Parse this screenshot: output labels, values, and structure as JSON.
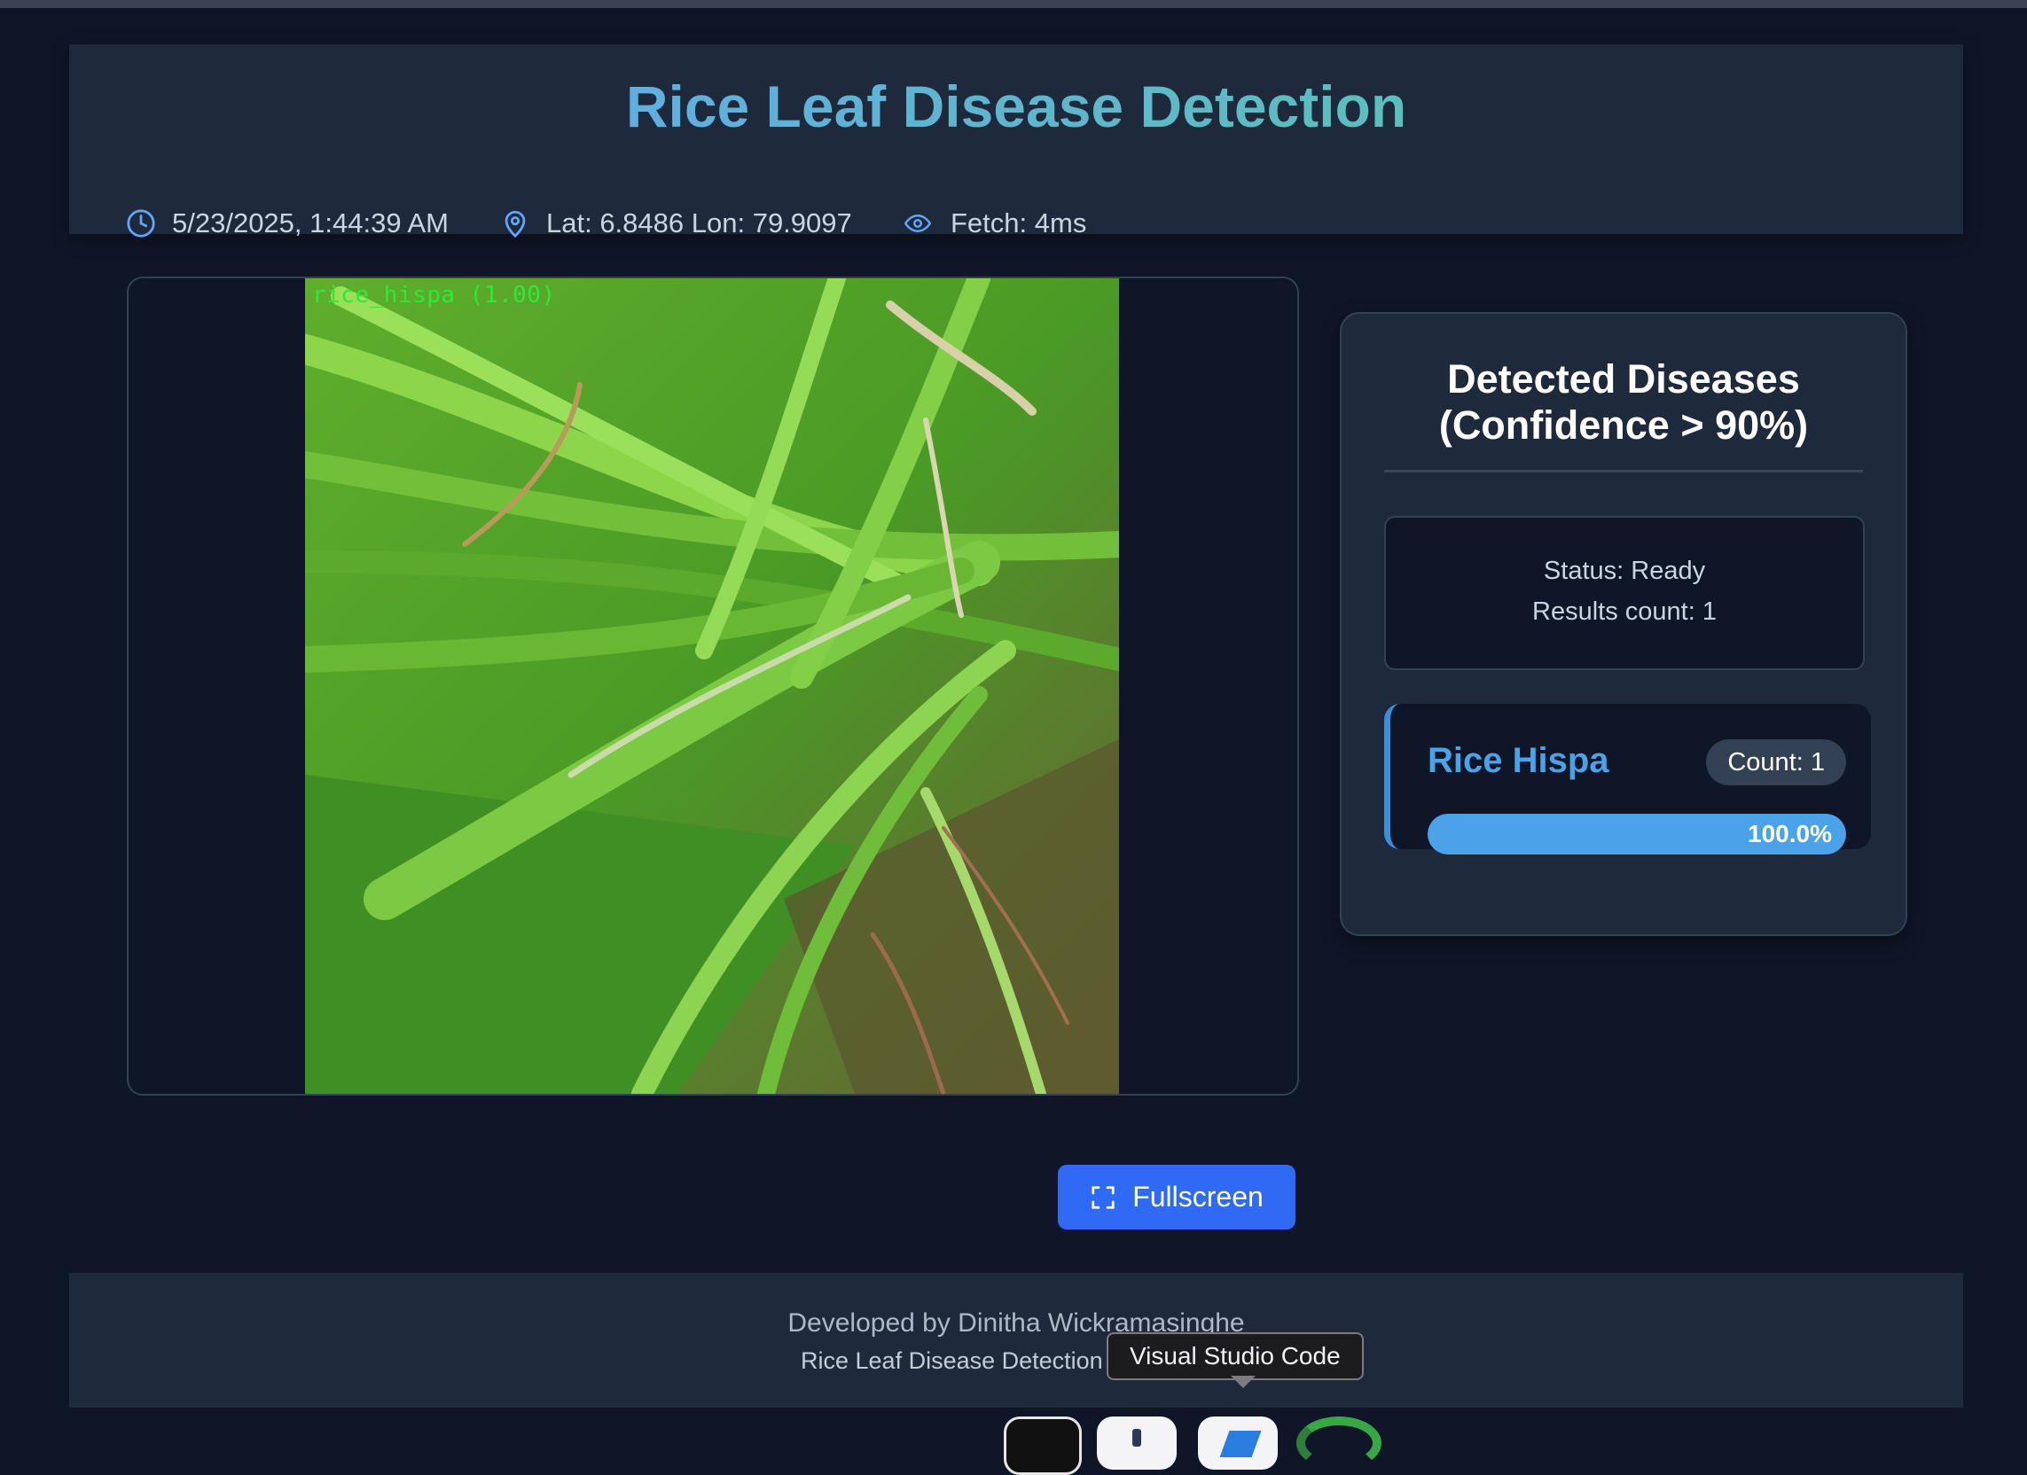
{
  "header": {
    "title": "Rice Leaf Disease Detection",
    "timestamp": "5/23/2025, 1:44:39 AM",
    "location": "Lat: 6.8486 Lon: 79.9097",
    "fetch": "Fetch: 4ms",
    "icons": [
      "clock-icon",
      "map-pin-icon",
      "eye-icon"
    ]
  },
  "camera": {
    "overlay_label": "rice_hispa (1.00)"
  },
  "controls": {
    "fullscreen_label": "Fullscreen"
  },
  "results": {
    "title_line1": "Detected Diseases",
    "title_line2": "(Confidence > 90%)",
    "status": "Status: Ready",
    "results_count": "Results count: 1",
    "items": [
      {
        "name": "Rice Hispa",
        "count_label": "Count: 1",
        "confidence": 100.0,
        "confidence_label": "100.0%"
      }
    ]
  },
  "footer": {
    "developer": "Developed by Dinitha Wickramasinghe",
    "app_line": "Rice Leaf Disease Detection S"
  },
  "tooltip": {
    "text": "Visual Studio Code"
  },
  "colors": {
    "background": "#0f1628",
    "panel": "#1e293b",
    "accent_blue": "#4aa3e8",
    "button_blue": "#2f6af5",
    "overlay_green": "#2ee83b"
  }
}
